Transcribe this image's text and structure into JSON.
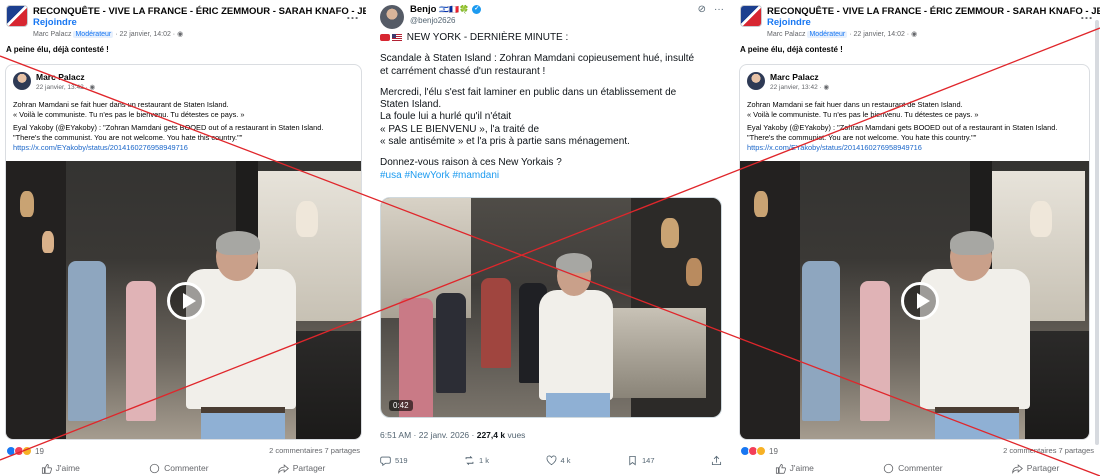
{
  "fb_post": {
    "group_name": "RECONQUÊTE - VIVE LA FRANCE - ÉRIC ZEMMOUR - SARAH KNAFO - JEAN MESSIHA -",
    "join_label": "Rejoindre",
    "poster": "Marc Palacz",
    "moderator_badge": "Modérateur",
    "post_date": "· 22 janvier, 14:02 ·",
    "caption": "A peine élu, déjà contesté !",
    "shared_author": "Marc Palacz",
    "shared_date": "22 janvier, 13:42 ·",
    "body_line1": "Zohran Mamdani se fait huer dans un restaurant de Staten Island.",
    "body_line2": "« Voilà le communiste. Tu n'es pas le bienvenu. Tu détestes ce pays. »",
    "body_line3": "Eyal Yakoby (@EYakoby) : \"Zohran Mamdani gets BOOED out of a restaurant in Staten Island.",
    "body_line4": "\"There's the communist. You are not welcome. You hate this country.\"\"",
    "body_link": "https://x.com/EYakoby/status/2014160276958949716",
    "reaction_count": "19",
    "comments": "2 commentaires",
    "shares": "7 partages",
    "actions": {
      "like": "J'aime",
      "comment": "Commenter",
      "share": "Partager"
    },
    "more": "…"
  },
  "tweet": {
    "name": "Benjo",
    "name_emojis": "🇮🇱🇫🇷🍀",
    "handle": "@benjo2626",
    "headline": "NEW YORK - DERNIÈRE MINUTE :",
    "para1_l1": "Scandale à Staten Island : Zohran Mamdani copieusement hué, insulté",
    "para1_l2": "et carrément chassé d'un restaurant !",
    "para2_l1": "Mercredi, l'élu s'est fait laminer en public dans un établissement de",
    "para2_l2": "Staten Island.",
    "para2_l3": "La foule lui a hurlé qu'il n'était",
    "para2_l4": "« PAS LE BIENVENU », l'a traité de",
    "para2_l5": "« sale antisémite » et l'a pris à partie sans ménagement.",
    "para3_l1": "Donnez-vous raison à ces New Yorkais ?",
    "hashtags": "#usa #NewYork #mamdani",
    "duration": "0:42",
    "time": "6:51 AM · 22 janv. 2026 ·",
    "views_count": "227,4 k",
    "views_label": "vues",
    "replies": "519",
    "retweets": "1 k",
    "likes": "4 k",
    "bookmarks": "147"
  },
  "colors": {
    "cross": "#e0262b",
    "fb_blue": "#1877f2",
    "x_blue": "#1d9bf0"
  }
}
